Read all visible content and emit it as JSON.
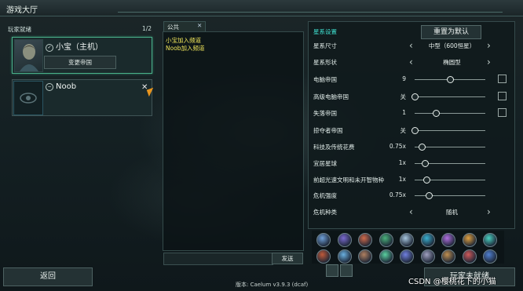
{
  "window": {
    "title": "游戏大厅"
  },
  "players": {
    "header": "玩家就绪",
    "count": "1/2",
    "list": [
      {
        "name": "小宝（主机）",
        "empire_button": "变更帝国"
      },
      {
        "name": "Noob",
        "kick": "✕"
      }
    ]
  },
  "chat": {
    "tab_label": "公共",
    "tab_close": "✕",
    "messages": [
      "小宝加入频道",
      "Noob加入频道"
    ],
    "input_value": "",
    "send_label": "发送"
  },
  "settings": {
    "header": "星系设置",
    "reset_label": "重置为默认",
    "rows": [
      {
        "label": "星系尺寸",
        "kind": "dropdown",
        "value": "中型（600恒星）"
      },
      {
        "label": "星系形状",
        "kind": "dropdown",
        "value": "椭圆型"
      },
      {
        "label": "电脑帝国",
        "kind": "slider",
        "value": "9",
        "level": 0.5,
        "checkbox": true
      },
      {
        "label": "高级电脑帝国",
        "kind": "slider",
        "value": "关",
        "level": 0.0,
        "checkbox": true
      },
      {
        "label": "失落帝国",
        "kind": "slider",
        "value": "1",
        "level": 0.3,
        "checkbox": true
      },
      {
        "label": "掠夺者帝国",
        "kind": "slider",
        "value": "关",
        "level": 0.0
      },
      {
        "label": "科技及传统花费",
        "kind": "slider",
        "value": "0.75x",
        "level": 0.1
      },
      {
        "label": "宜居星球",
        "kind": "slider",
        "value": "1x",
        "level": 0.14
      },
      {
        "label": "前超光速文明和未开智物种",
        "kind": "slider",
        "value": "1x",
        "level": 0.17
      },
      {
        "label": "危机强度",
        "kind": "slider",
        "value": "0.75x",
        "level": 0.2
      },
      {
        "label": "危机种类",
        "kind": "dropdown",
        "value": "随机"
      }
    ]
  },
  "empire_icons": [
    "empire-icon"
  ],
  "buttons": {
    "back": "返回",
    "ready": "玩家未就绪"
  },
  "footer": {
    "version": "版本: Caelum v3.9.3 (dcaf)"
  },
  "watermark": "CSDN @樱桃花下的小猫"
}
